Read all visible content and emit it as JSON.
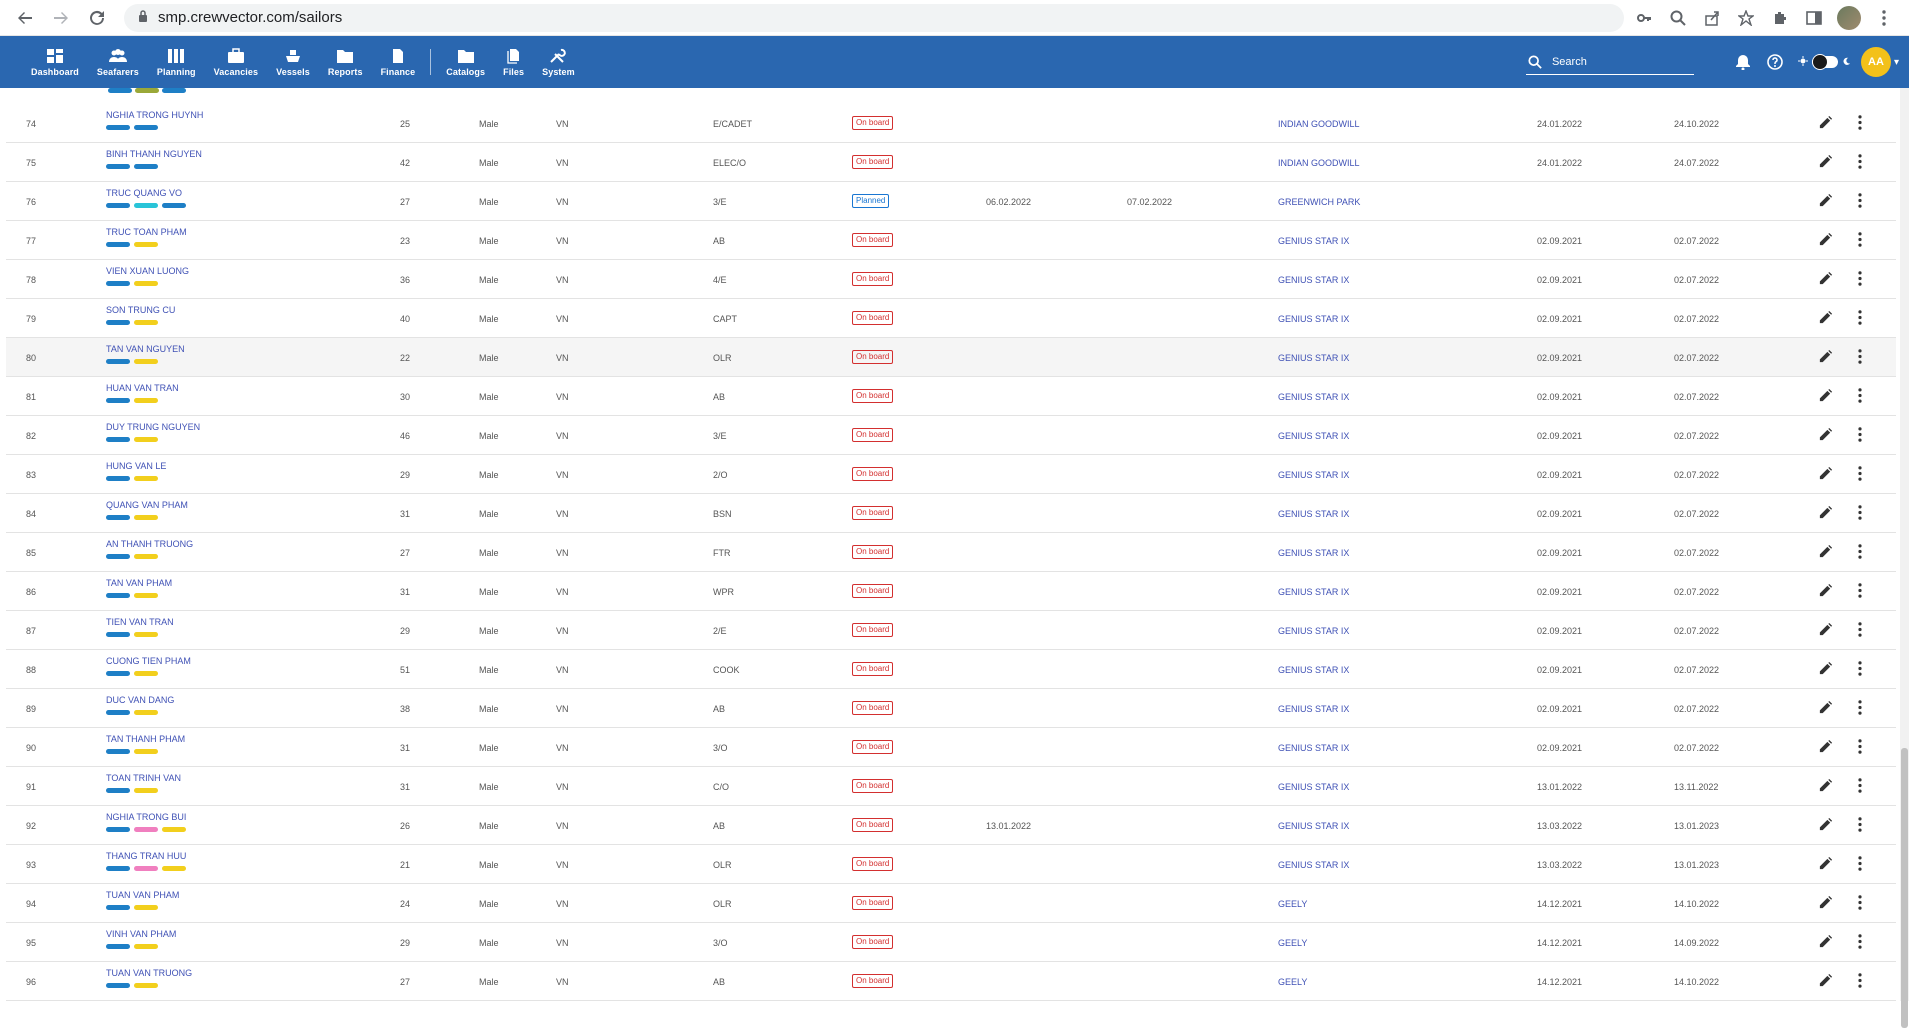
{
  "browser": {
    "url": "smp.crewvector.com/sailors"
  },
  "nav": {
    "items": [
      {
        "label": "Dashboard",
        "icon": "dashboard-icon"
      },
      {
        "label": "Seafarers",
        "icon": "seafarers-icon"
      },
      {
        "label": "Planning",
        "icon": "planning-icon"
      },
      {
        "label": "Vacancies",
        "icon": "vacancies-icon"
      },
      {
        "label": "Vessels",
        "icon": "vessels-icon"
      },
      {
        "label": "Reports",
        "icon": "reports-icon"
      },
      {
        "label": "Finance",
        "icon": "finance-icon"
      },
      {
        "label": "Catalogs",
        "icon": "catalogs-icon"
      },
      {
        "label": "Files",
        "icon": "files-icon"
      },
      {
        "label": "System",
        "icon": "system-icon"
      }
    ]
  },
  "header": {
    "search_placeholder": "Search",
    "avatar_initials": "AA"
  },
  "colors": {
    "header_bg": "#2a67b0",
    "tag_blue": "#1e7fc6",
    "tag_yellow": "#f2cf1d",
    "tag_cyan": "#29c4d8",
    "tag_pink": "#f07fbf",
    "onboard": "#d32f2f",
    "planned": "#1976d2",
    "link": "#3f51b5"
  },
  "rows": [
    {
      "num": "74",
      "name": "NGHIA TRONG HUYNH",
      "tags": [
        "blue",
        "blue"
      ],
      "age": "25",
      "gender": "Male",
      "nat": "VN",
      "rank": "E/CADET",
      "status": "On board",
      "status_type": "onboard",
      "d1": "",
      "d2": "",
      "vessel": "INDIAN GOODWILL",
      "from": "24.01.2022",
      "to": "24.10.2022"
    },
    {
      "num": "75",
      "name": "BINH THANH NGUYEN",
      "tags": [
        "blue",
        "blue"
      ],
      "age": "42",
      "gender": "Male",
      "nat": "VN",
      "rank": "ELEC/O",
      "status": "On board",
      "status_type": "onboard",
      "d1": "",
      "d2": "",
      "vessel": "INDIAN GOODWILL",
      "from": "24.01.2022",
      "to": "24.07.2022"
    },
    {
      "num": "76",
      "name": "TRUC QUANG VO",
      "tags": [
        "blue",
        "cyan",
        "blue"
      ],
      "age": "27",
      "gender": "Male",
      "nat": "VN",
      "rank": "3/E",
      "status": "Planned",
      "status_type": "planned",
      "d1": "06.02.2022",
      "d2": "07.02.2022",
      "vessel": "GREENWICH PARK",
      "from": "",
      "to": ""
    },
    {
      "num": "77",
      "name": "TRUC TOAN PHAM",
      "tags": [
        "blue",
        "yellow"
      ],
      "age": "23",
      "gender": "Male",
      "nat": "VN",
      "rank": "AB",
      "status": "On board",
      "status_type": "onboard",
      "d1": "",
      "d2": "",
      "vessel": "GENIUS STAR IX",
      "from": "02.09.2021",
      "to": "02.07.2022"
    },
    {
      "num": "78",
      "name": "VIEN XUAN LUONG",
      "tags": [
        "blue",
        "yellow"
      ],
      "age": "36",
      "gender": "Male",
      "nat": "VN",
      "rank": "4/E",
      "status": "On board",
      "status_type": "onboard",
      "d1": "",
      "d2": "",
      "vessel": "GENIUS STAR IX",
      "from": "02.09.2021",
      "to": "02.07.2022"
    },
    {
      "num": "79",
      "name": "SON TRUNG CU",
      "tags": [
        "blue",
        "yellow"
      ],
      "age": "40",
      "gender": "Male",
      "nat": "VN",
      "rank": "CAPT",
      "status": "On board",
      "status_type": "onboard",
      "d1": "",
      "d2": "",
      "vessel": "GENIUS STAR IX",
      "from": "02.09.2021",
      "to": "02.07.2022"
    },
    {
      "num": "80",
      "name": "TAN VAN NGUYEN",
      "tags": [
        "blue",
        "yellow"
      ],
      "age": "22",
      "gender": "Male",
      "nat": "VN",
      "rank": "OLR",
      "status": "On board",
      "status_type": "onboard",
      "d1": "",
      "d2": "",
      "vessel": "GENIUS STAR IX",
      "from": "02.09.2021",
      "to": "02.07.2022",
      "highlight": true
    },
    {
      "num": "81",
      "name": "HUAN VAN TRAN",
      "tags": [
        "blue",
        "yellow"
      ],
      "age": "30",
      "gender": "Male",
      "nat": "VN",
      "rank": "AB",
      "status": "On board",
      "status_type": "onboard",
      "d1": "",
      "d2": "",
      "vessel": "GENIUS STAR IX",
      "from": "02.09.2021",
      "to": "02.07.2022"
    },
    {
      "num": "82",
      "name": "DUY TRUNG NGUYEN",
      "tags": [
        "blue",
        "yellow"
      ],
      "age": "46",
      "gender": "Male",
      "nat": "VN",
      "rank": "3/E",
      "status": "On board",
      "status_type": "onboard",
      "d1": "",
      "d2": "",
      "vessel": "GENIUS STAR IX",
      "from": "02.09.2021",
      "to": "02.07.2022"
    },
    {
      "num": "83",
      "name": "HUNG VAN LE",
      "tags": [
        "blue",
        "yellow"
      ],
      "age": "29",
      "gender": "Male",
      "nat": "VN",
      "rank": "2/O",
      "status": "On board",
      "status_type": "onboard",
      "d1": "",
      "d2": "",
      "vessel": "GENIUS STAR IX",
      "from": "02.09.2021",
      "to": "02.07.2022"
    },
    {
      "num": "84",
      "name": "QUANG VAN PHAM",
      "tags": [
        "blue",
        "yellow"
      ],
      "age": "31",
      "gender": "Male",
      "nat": "VN",
      "rank": "BSN",
      "status": "On board",
      "status_type": "onboard",
      "d1": "",
      "d2": "",
      "vessel": "GENIUS STAR IX",
      "from": "02.09.2021",
      "to": "02.07.2022"
    },
    {
      "num": "85",
      "name": "AN THANH TRUONG",
      "tags": [
        "blue",
        "yellow"
      ],
      "age": "27",
      "gender": "Male",
      "nat": "VN",
      "rank": "FTR",
      "status": "On board",
      "status_type": "onboard",
      "d1": "",
      "d2": "",
      "vessel": "GENIUS STAR IX",
      "from": "02.09.2021",
      "to": "02.07.2022"
    },
    {
      "num": "86",
      "name": "TAN VAN PHAM",
      "tags": [
        "blue",
        "yellow"
      ],
      "age": "31",
      "gender": "Male",
      "nat": "VN",
      "rank": "WPR",
      "status": "On board",
      "status_type": "onboard",
      "d1": "",
      "d2": "",
      "vessel": "GENIUS STAR IX",
      "from": "02.09.2021",
      "to": "02.07.2022"
    },
    {
      "num": "87",
      "name": "TIEN VAN TRAN",
      "tags": [
        "blue",
        "yellow"
      ],
      "age": "29",
      "gender": "Male",
      "nat": "VN",
      "rank": "2/E",
      "status": "On board",
      "status_type": "onboard",
      "d1": "",
      "d2": "",
      "vessel": "GENIUS STAR IX",
      "from": "02.09.2021",
      "to": "02.07.2022"
    },
    {
      "num": "88",
      "name": "CUONG TIEN PHAM",
      "tags": [
        "blue",
        "yellow"
      ],
      "age": "51",
      "gender": "Male",
      "nat": "VN",
      "rank": "COOK",
      "status": "On board",
      "status_type": "onboard",
      "d1": "",
      "d2": "",
      "vessel": "GENIUS STAR IX",
      "from": "02.09.2021",
      "to": "02.07.2022"
    },
    {
      "num": "89",
      "name": "DUC VAN DANG",
      "tags": [
        "blue",
        "yellow"
      ],
      "age": "38",
      "gender": "Male",
      "nat": "VN",
      "rank": "AB",
      "status": "On board",
      "status_type": "onboard",
      "d1": "",
      "d2": "",
      "vessel": "GENIUS STAR IX",
      "from": "02.09.2021",
      "to": "02.07.2022"
    },
    {
      "num": "90",
      "name": "TAN THANH PHAM",
      "tags": [
        "blue",
        "yellow"
      ],
      "age": "31",
      "gender": "Male",
      "nat": "VN",
      "rank": "3/O",
      "status": "On board",
      "status_type": "onboard",
      "d1": "",
      "d2": "",
      "vessel": "GENIUS STAR IX",
      "from": "02.09.2021",
      "to": "02.07.2022"
    },
    {
      "num": "91",
      "name": "TOAN TRINH VAN",
      "tags": [
        "blue",
        "yellow"
      ],
      "age": "31",
      "gender": "Male",
      "nat": "VN",
      "rank": "C/O",
      "status": "On board",
      "status_type": "onboard",
      "d1": "",
      "d2": "",
      "vessel": "GENIUS STAR IX",
      "from": "13.01.2022",
      "to": "13.11.2022"
    },
    {
      "num": "92",
      "name": "NGHIA TRONG BUI",
      "tags": [
        "blue",
        "pink",
        "yellow"
      ],
      "age": "26",
      "gender": "Male",
      "nat": "VN",
      "rank": "AB",
      "status": "On board",
      "status_type": "onboard",
      "d1": "13.01.2022",
      "d2": "",
      "vessel": "GENIUS STAR IX",
      "from": "13.03.2022",
      "to": "13.01.2023"
    },
    {
      "num": "93",
      "name": "THANG TRAN HUU",
      "tags": [
        "blue",
        "pink",
        "yellow"
      ],
      "age": "21",
      "gender": "Male",
      "nat": "VN",
      "rank": "OLR",
      "status": "On board",
      "status_type": "onboard",
      "d1": "",
      "d2": "",
      "vessel": "GENIUS STAR IX",
      "from": "13.03.2022",
      "to": "13.01.2023"
    },
    {
      "num": "94",
      "name": "TUAN VAN PHAM",
      "tags": [
        "blue",
        "yellow"
      ],
      "age": "24",
      "gender": "Male",
      "nat": "VN",
      "rank": "OLR",
      "status": "On board",
      "status_type": "onboard",
      "d1": "",
      "d2": "",
      "vessel": "GEELY",
      "from": "14.12.2021",
      "to": "14.10.2022"
    },
    {
      "num": "95",
      "name": "VINH VAN PHAM",
      "tags": [
        "blue",
        "yellow"
      ],
      "age": "29",
      "gender": "Male",
      "nat": "VN",
      "rank": "3/O",
      "status": "On board",
      "status_type": "onboard",
      "d1": "",
      "d2": "",
      "vessel": "GEELY",
      "from": "14.12.2021",
      "to": "14.09.2022"
    },
    {
      "num": "96",
      "name": "TUAN VAN TRUONG",
      "tags": [
        "blue",
        "yellow"
      ],
      "age": "27",
      "gender": "Male",
      "nat": "VN",
      "rank": "AB",
      "status": "On board",
      "status_type": "onboard",
      "d1": "",
      "d2": "",
      "vessel": "GEELY",
      "from": "14.12.2021",
      "to": "14.10.2022"
    }
  ]
}
